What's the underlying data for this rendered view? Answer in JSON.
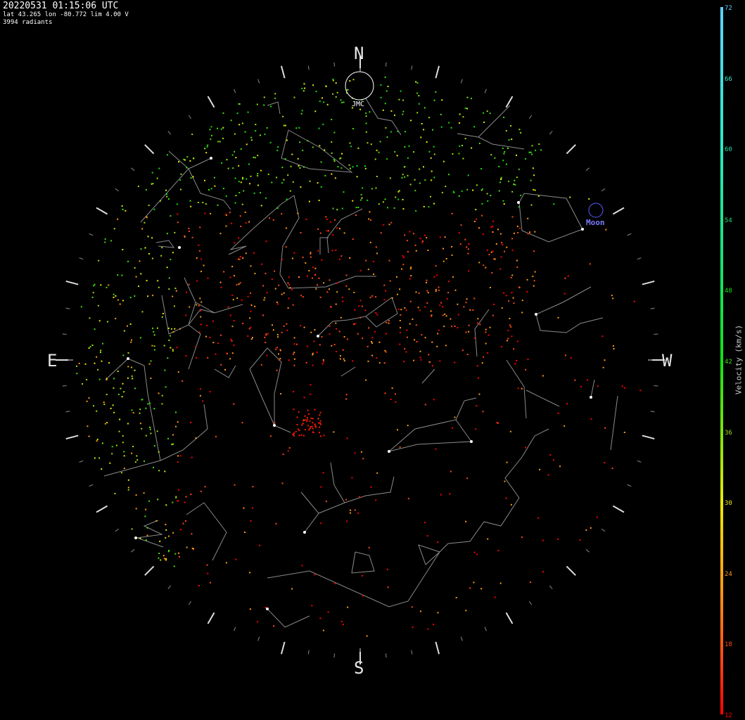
{
  "header": {
    "timestamp": "20220531 01:15:06 UTC",
    "location": "lat 43.265 lon -80.772 lim 4.00 V",
    "radiant_count": "3994 radiants"
  },
  "cardinals": {
    "north": "N",
    "south": "S",
    "east": "E",
    "west": "W"
  },
  "annotations": {
    "jmc": {
      "label": "JMC",
      "color": "#ffffff"
    },
    "moon": {
      "label": "Moon",
      "color": "#7b7bff"
    }
  },
  "colorbar": {
    "label": "Velocity (km/s)",
    "ticks": [
      "72",
      "66",
      "60",
      "54",
      "48",
      "42",
      "36",
      "30",
      "24",
      "18",
      "12"
    ],
    "tick_colors": [
      "#5fd0ff",
      "#2ee8c8",
      "#19e0a0",
      "#19e070",
      "#14e014",
      "#40e010",
      "#a0e00e",
      "#e8e80a",
      "#ff9a14",
      "#ff4a14",
      "#ff0000"
    ]
  },
  "colors": {
    "background": "#000000",
    "constellation_lines": "#8a8a8a",
    "star": "#ffffff"
  }
}
